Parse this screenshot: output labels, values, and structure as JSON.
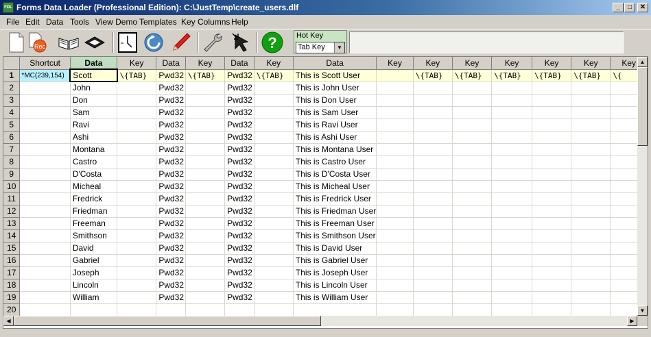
{
  "window": {
    "title": "Forms Data Loader (Professional Edition): C:\\JustTemp\\create_users.dlf",
    "app_icon": "FDL",
    "minimize_glyph": "_",
    "maximize_glyph": "□",
    "close_glyph": "✕"
  },
  "menu": [
    "File",
    "Edit",
    "Data",
    "Tools",
    "View Demo",
    "Templates",
    "Key Columns",
    "Help"
  ],
  "toolbar": {
    "buttons": [
      "new-document-icon",
      "record-icon",
      "open-book-icon",
      "open-file-icon",
      "clock-icon",
      "refresh-icon",
      "pencil-icon",
      "wrench-icon",
      "cursor-hand-icon",
      "help-icon"
    ],
    "rec_label": "Rec",
    "help_glyph": "?"
  },
  "hotkey": {
    "label": "Hot Key",
    "value": "Tab Key",
    "arrow": "▼"
  },
  "grid": {
    "columns": [
      "Shortcut",
      "Data",
      "Key",
      "Data",
      "Key",
      "Data",
      "Key",
      "Data",
      "Key",
      "Key",
      "Key",
      "Key",
      "Key",
      "Key",
      "Key"
    ],
    "row_numbers": [
      "1",
      "2",
      "3",
      "4",
      "5",
      "6",
      "7",
      "8",
      "9",
      "10",
      "11",
      "12",
      "13",
      "14",
      "15",
      "16",
      "17",
      "18",
      "19",
      "20"
    ],
    "shortcut_value": "*MC(239,154)",
    "key_value": "\\{TAB}",
    "password": "Pwd32",
    "names": [
      "Scott",
      "John",
      "Don",
      "Sam",
      "Ravi",
      "Ashi",
      "Montana",
      "Castro",
      "D'Costa",
      "Micheal",
      "Fredrick",
      "Friedman",
      "Freeman",
      "Smithson",
      "David",
      "Gabriel",
      "Joseph",
      "Lincoln",
      "William"
    ],
    "descriptions": [
      "This is Scott User",
      "This is John User",
      "This is Don User",
      "This is Sam User",
      "This is Ravi User",
      "This is Ashi User",
      "This is Montana User",
      "This is Castro User",
      "This is D'Costa User",
      "This is Micheal User",
      "This is Fredrick User",
      "This is Friedman User",
      "This is Freeman User",
      "This is Smithson User",
      "This is David User",
      "This is Gabriel User",
      "This is Joseph User",
      "This is Lincoln User",
      "This is William User"
    ],
    "last_key": "\\{"
  },
  "scroll": {
    "up": "▲",
    "down": "▼",
    "left": "◀",
    "right": "▶"
  }
}
